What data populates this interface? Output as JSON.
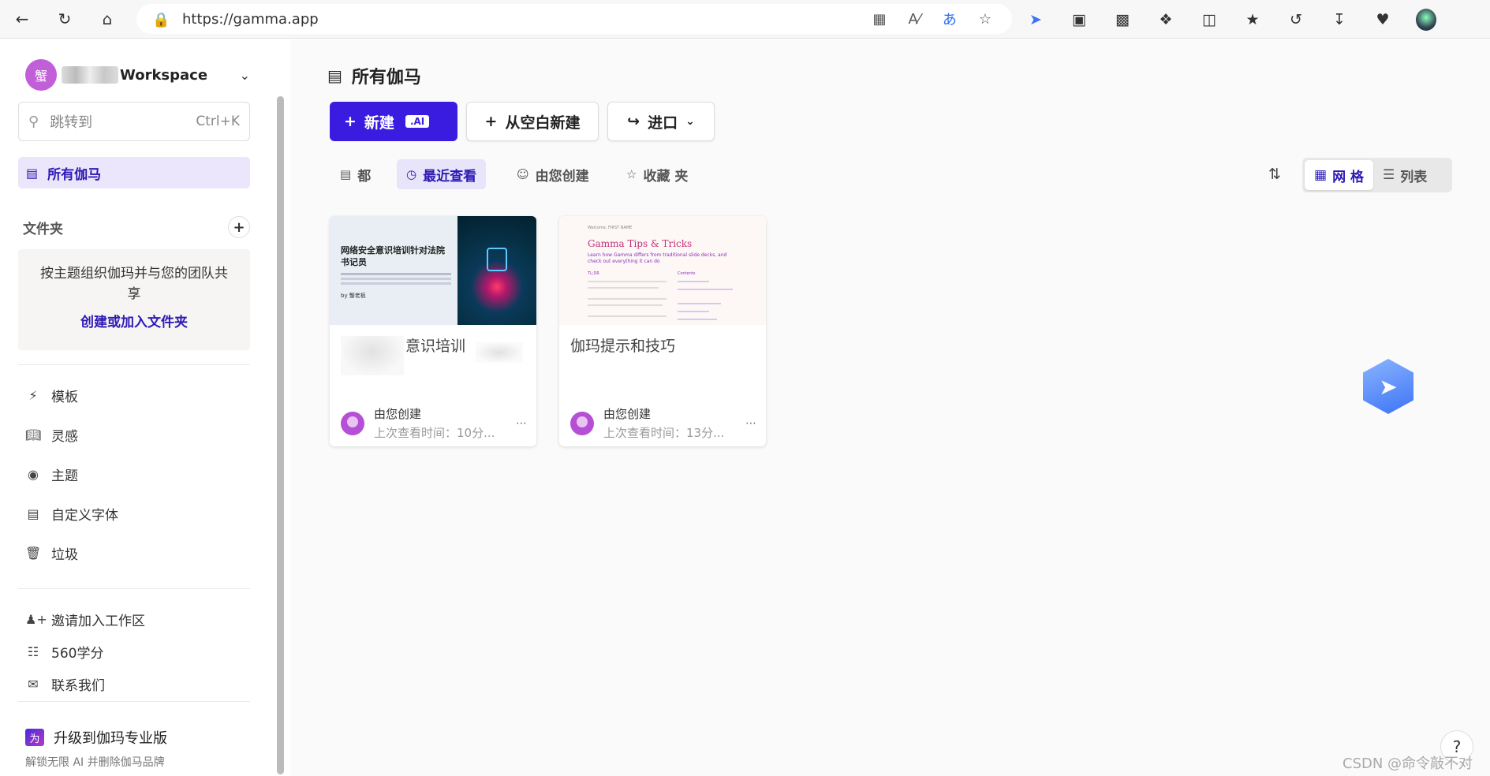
{
  "browser": {
    "url": "https://gamma.app"
  },
  "sidebar": {
    "workspace_initial": "蟹",
    "workspace_name": "Workspace",
    "search_placeholder": "跳转到",
    "search_shortcut": "Ctrl+K",
    "active_item": "所有伽马",
    "folders_label": "文件夹",
    "folders_desc": "按主题组织伽玛并与您的团队共享",
    "folders_link": "创建或加入文件夹",
    "menu": [
      "模板",
      "灵感",
      "主题",
      "自定义字体",
      "垃圾"
    ],
    "bottom": [
      "邀请加入工作区",
      "560学分",
      "联系我们"
    ],
    "upgrade_badge": "为",
    "upgrade_label": "升级到伽玛专业版",
    "upgrade_sub": "解锁无限 AI 并删除伽马品牌"
  },
  "main": {
    "title": "所有伽马",
    "new_btn": "新建",
    "ai_tag": ".AI",
    "blank_btn": "从空白新建",
    "import_btn": "进口",
    "filters": [
      "都",
      "最近查看",
      "由您创建",
      "收藏 夹"
    ],
    "active_filter": "最近查看",
    "view_grid": "网 格",
    "view_list": "列表",
    "cards": [
      {
        "title": "意识培训",
        "thumb_title": "网络安全意识培训针对法院书记员",
        "thumb_by": "by 蟹老板",
        "by": "由您创建",
        "time": "上次查看时间：10分..."
      },
      {
        "title": "伽玛提示和技巧",
        "thumb_title": "Gamma Tips & Tricks",
        "thumb_small": "Welcome, FIRST NAME",
        "thumb_sub": "Learn how Gamma differs from traditional slide decks, and check out everything it can do",
        "thumb_tldr": "TL;DR",
        "thumb_contents": "Contents",
        "by": "由您创建",
        "time": "上次查看时间：13分..."
      }
    ]
  },
  "watermark": "CSDN @命令敲不对",
  "colors": {
    "accent": "#3a1be0",
    "active_text": "#2d1ab5",
    "active_bg": "#ebe6fb"
  }
}
